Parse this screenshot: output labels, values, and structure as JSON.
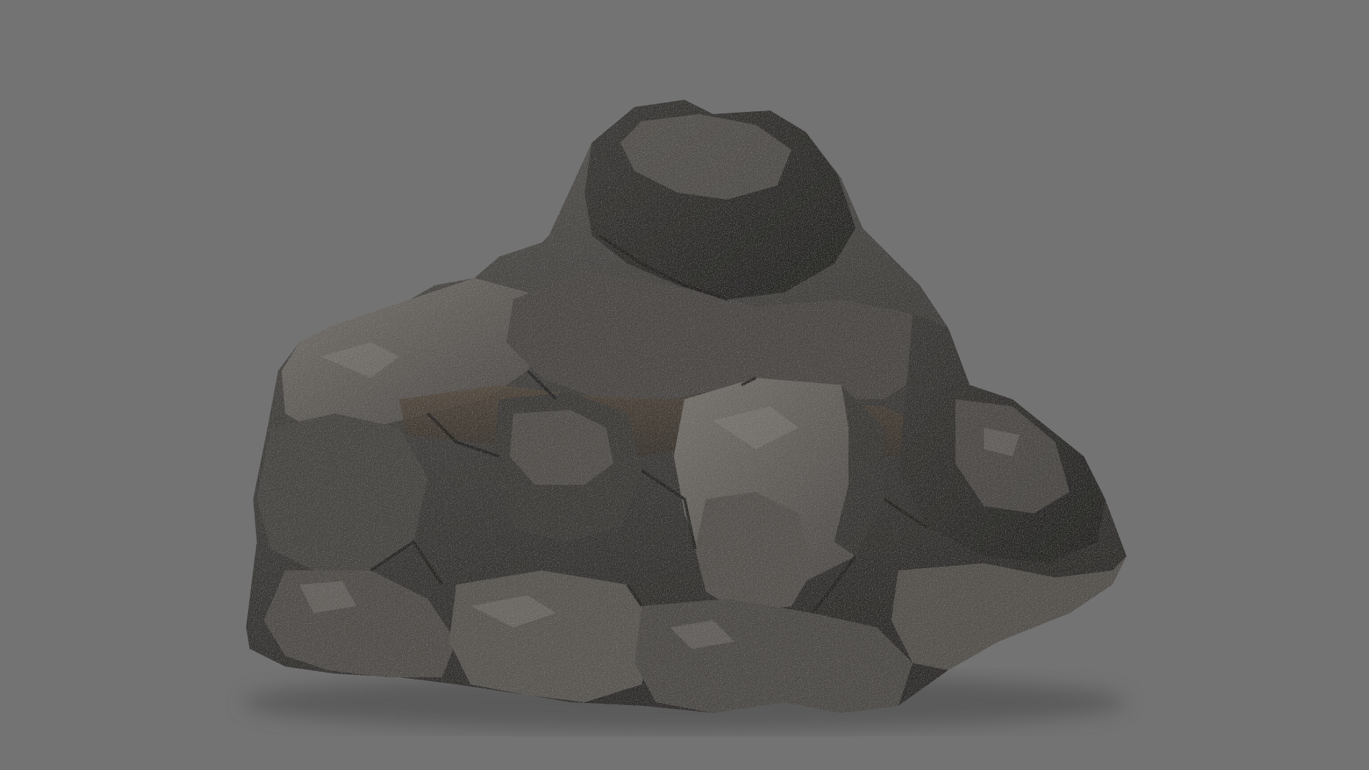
{
  "scene": {
    "subject": "rock-formation",
    "background_color": "#737373",
    "palette": {
      "rock_dark": "#2b2a28",
      "rock_mid": "#4a4845",
      "rock_light": "#6e6b67",
      "rock_highlight": "#8c8883",
      "soil_brown": "#4a3f33",
      "shadow": "#3f3f3f"
    }
  }
}
